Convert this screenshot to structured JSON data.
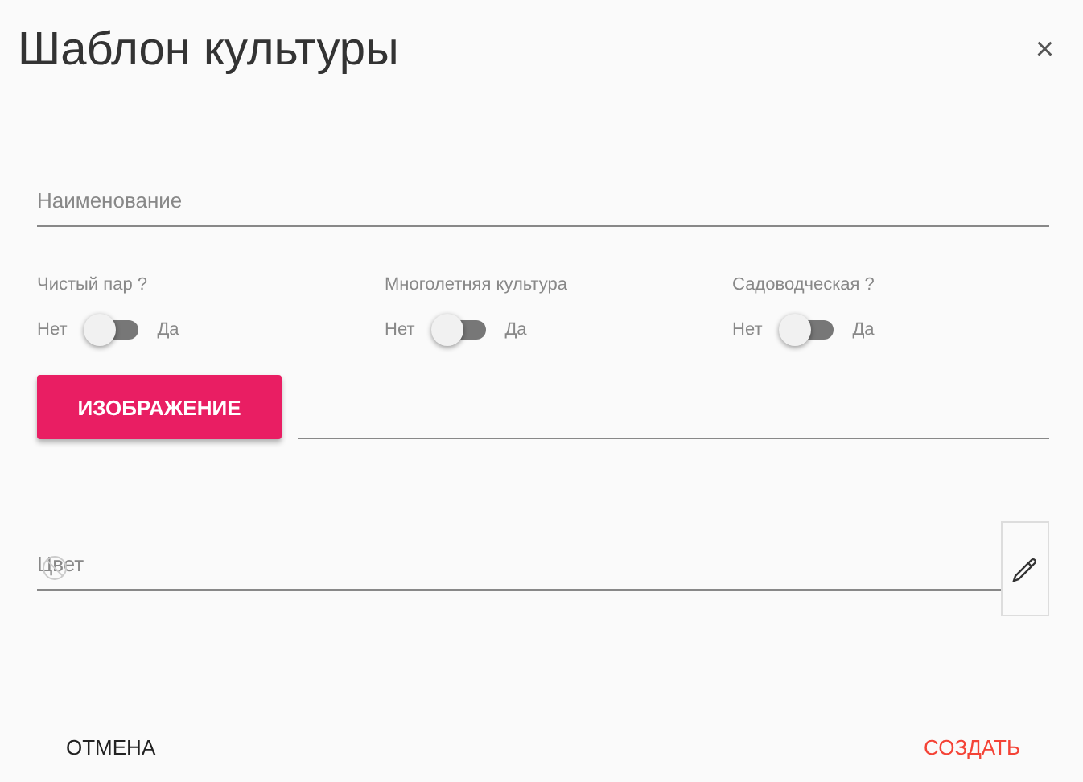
{
  "dialog": {
    "title": "Шаблон культуры",
    "close": "×"
  },
  "name_field": {
    "placeholder": "Наименование"
  },
  "toggles": [
    {
      "label": "Чистый пар ?",
      "off_label": "Нет",
      "on_label": "Да",
      "on": false
    },
    {
      "label": "Многолетняя культура",
      "off_label": "Нет",
      "on_label": "Да",
      "on": false
    },
    {
      "label": "Садоводческая ?",
      "off_label": "Нет",
      "on_label": "Да",
      "on": false
    }
  ],
  "image_button": "ИЗОБРАЖЕНИЕ",
  "color_field": {
    "placeholder": "Цвет"
  },
  "actions": {
    "cancel": "ОТМЕНА",
    "create": "СОЗДАТЬ"
  }
}
